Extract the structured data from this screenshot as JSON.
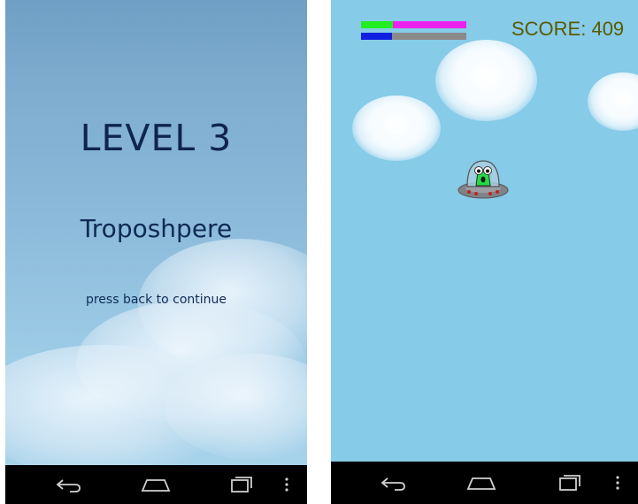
{
  "level_screen": {
    "title": "LEVEL 3",
    "subtitle": "Troposhpere",
    "hint": "press back to continue"
  },
  "game_screen": {
    "score_text": "SCORE: 409",
    "health_bar": {
      "fill_color": "#22ee22",
      "track_color": "#ee22ee",
      "level": 0.3
    },
    "energy_bar": {
      "fill_color": "#1020e0",
      "track_color": "#8a8a8a",
      "level": 0.29
    },
    "player": "ufo-alien"
  },
  "navbar": {
    "buttons": [
      "back-icon",
      "home-icon",
      "recent-apps-icon",
      "menu-icon"
    ]
  },
  "colors": {
    "level_text": "#0f2450",
    "score_text": "#5a5a00",
    "sky": "#86cbe8",
    "navbar": "#000000"
  }
}
